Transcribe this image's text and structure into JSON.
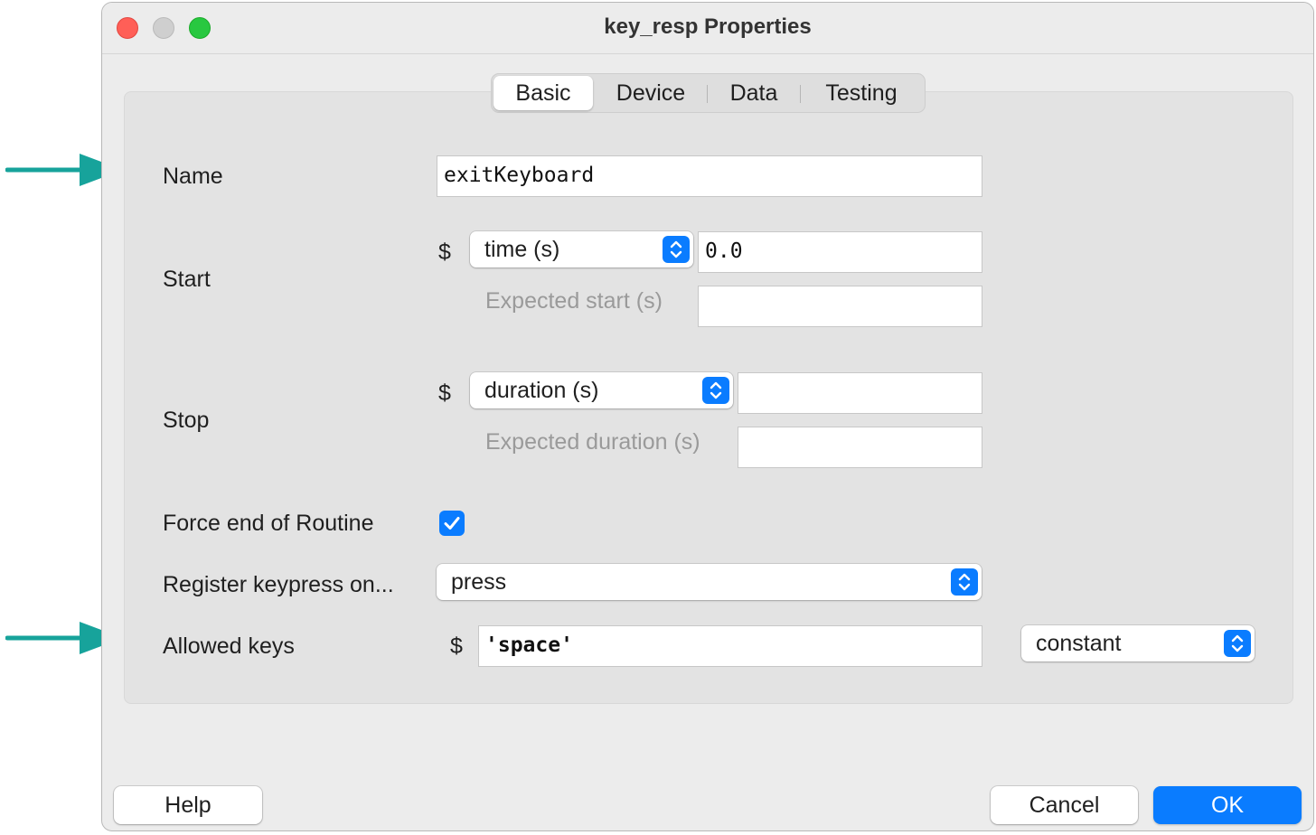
{
  "window": {
    "title": "key_resp Properties"
  },
  "tabs": [
    "Basic",
    "Device",
    "Data",
    "Testing"
  ],
  "active_tab": "Basic",
  "form": {
    "name": {
      "label": "Name",
      "value": "exitKeyboard"
    },
    "start": {
      "label": "Start",
      "dollar": "$",
      "type_value": "time (s)",
      "value": "0.0",
      "expected_label": "Expected start (s)",
      "expected_value": ""
    },
    "stop": {
      "label": "Stop",
      "dollar": "$",
      "type_value": "duration (s)",
      "value": "",
      "expected_label": "Expected duration (s)",
      "expected_value": ""
    },
    "force_end": {
      "label": "Force end of Routine",
      "checked": true
    },
    "register": {
      "label": "Register keypress on...",
      "value": "press"
    },
    "allowed_keys": {
      "label": "Allowed keys",
      "dollar": "$",
      "value": "'space'",
      "update_value": "constant"
    }
  },
  "buttons": {
    "help": "Help",
    "cancel": "Cancel",
    "ok": "OK"
  },
  "colors": {
    "accent": "#0a7cff",
    "annotation_arrow": "#17a39b"
  }
}
